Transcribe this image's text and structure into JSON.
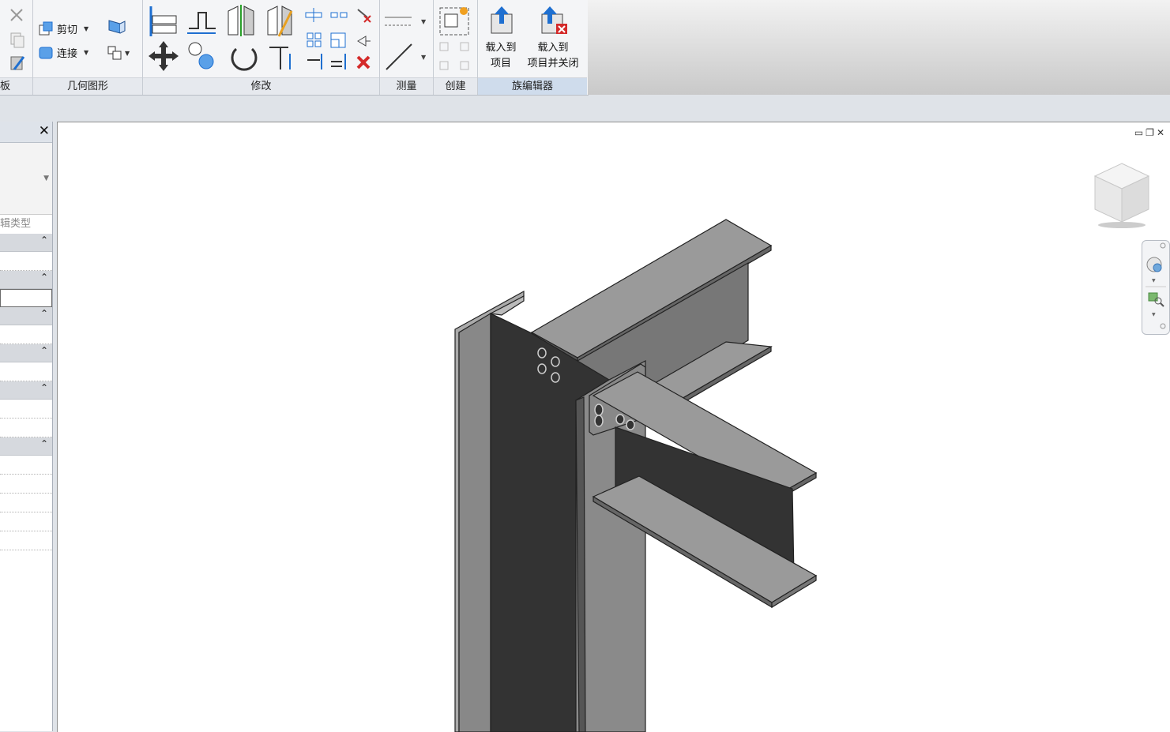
{
  "ribbon": {
    "panels": {
      "clipboard": "板",
      "geometry": "几何图形",
      "modify": "修改",
      "measure": "测量",
      "create": "创建",
      "family_editor": "族编辑器"
    },
    "geometry": {
      "cut_label": "剪切",
      "join_label": "连接"
    },
    "family_editor": {
      "load_to_project": "载入到\n项目",
      "load_to_project_close": "载入到\n项目并关闭"
    }
  },
  "properties": {
    "edit_type_label": "编辑类型"
  },
  "colors": {
    "steel_light": "#9a9a9a",
    "steel_mid": "#777777",
    "steel_dark": "#333333",
    "accent_blue": "#1e6fd0",
    "delete_red": "#d42a2a"
  }
}
